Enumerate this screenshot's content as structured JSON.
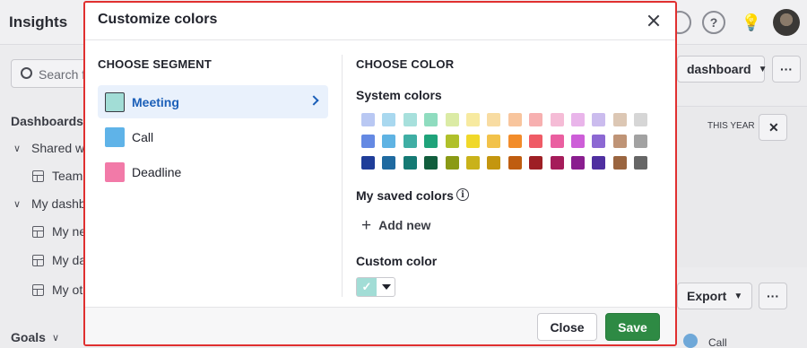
{
  "background": {
    "app_title": "Insights",
    "search_placeholder": "Search f",
    "dashboards_heading": "Dashboards",
    "shared_group": "Shared w",
    "shared_item": "Team",
    "my_group": "My dashb",
    "my_items": [
      "My ne",
      "My da",
      "My ot"
    ],
    "goals_heading": "Goals",
    "dashboard_button": "dashboard",
    "period_label": "THIS YEAR",
    "export_button": "Export",
    "bottom_legend": "Call",
    "more_label": "···",
    "help_glyph": "?",
    "bulb_glyph": "💡"
  },
  "modal": {
    "title": "Customize colors",
    "segment_heading": "CHOOSE SEGMENT",
    "color_heading": "CHOOSE COLOR",
    "segments": [
      {
        "label": "Meeting",
        "color": "#a2ddd6",
        "active": true
      },
      {
        "label": "Call",
        "color": "#5fb3e8",
        "active": false
      },
      {
        "label": "Deadline",
        "color": "#f27aa8",
        "active": false
      }
    ],
    "system_colors_label": "System colors",
    "system_colors": [
      [
        "#b9c8f3",
        "#a9d8ef",
        "#a7e0dc",
        "#8fdcbf",
        "#dbeba5",
        "#f7eaa0",
        "#f8dca2",
        "#f8c59d",
        "#f7b0b0",
        "#f5bcd6",
        "#e9b5ea",
        "#cbbcee",
        "#dcc7b4",
        "#d6d6d6"
      ],
      [
        "#6489e3",
        "#5fb3e3",
        "#3faea4",
        "#1fa37a",
        "#b0c02a",
        "#f0d82a",
        "#f2c24a",
        "#f28c2a",
        "#ef5b66",
        "#ea5fa0",
        "#cd5ed8",
        "#8c68d3",
        "#bf9476",
        "#a2a2a2"
      ],
      [
        "#1f3d99",
        "#1f6aa0",
        "#157a74",
        "#115e3d",
        "#8a9a15",
        "#c9b21a",
        "#c4960f",
        "#bf5d10",
        "#9e1f25",
        "#a51c5a",
        "#8a1e8f",
        "#4f2fa0",
        "#9a6540",
        "#666666"
      ]
    ],
    "saved_colors_label": "My saved colors",
    "info_glyph": "i",
    "add_new_label": "Add new",
    "plus_glyph": "+",
    "custom_color_label": "Custom color",
    "custom_color_value": "#a2ddd6",
    "check_glyph": "✓",
    "close_button": "Close",
    "save_button": "Save"
  }
}
